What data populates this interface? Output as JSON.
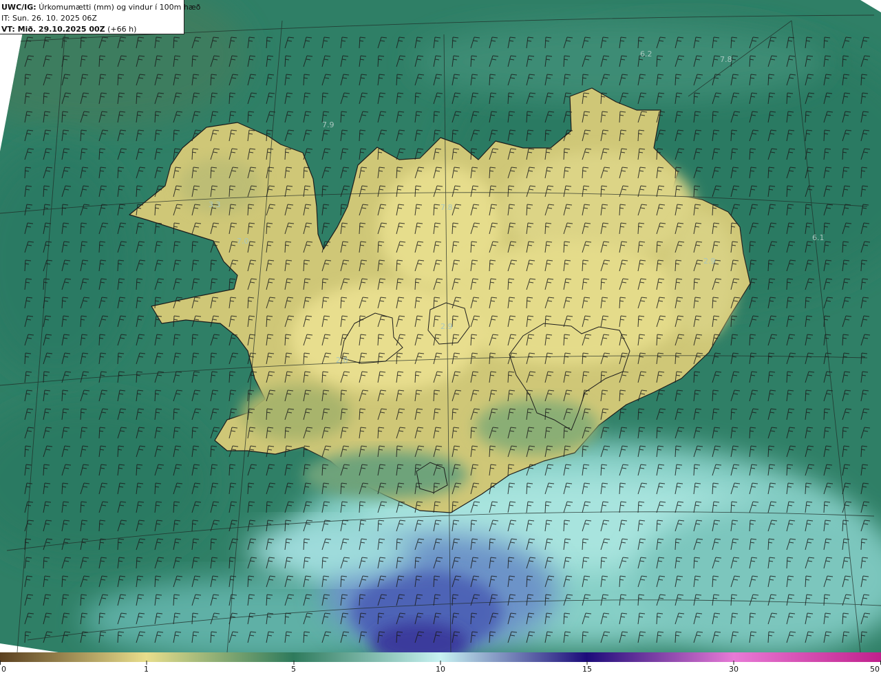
{
  "header": {
    "product_prefix": "UWC/IG:",
    "product_desc": "Úrkomumætti (mm) og vindur í 100m hæð",
    "init_time": "IT: Sun. 26. 10. 2025 06Z",
    "valid_prefix": "VT: Mið. 29.10.2025 00Z",
    "valid_suffix": "(+66 h)"
  },
  "map_labels": [
    {
      "text": "6.2"
    },
    {
      "text": "7.8"
    },
    {
      "text": "7.9"
    },
    {
      "text": "3.3"
    },
    {
      "text": "7.0"
    },
    {
      "text": "7.8"
    },
    {
      "text": "6.1"
    },
    {
      "text": "2.9"
    },
    {
      "text": "2.9"
    },
    {
      "text": "2.0"
    }
  ],
  "legend": {
    "ticks": [
      "0",
      "1",
      "5",
      "10",
      "15",
      "30",
      "50"
    ],
    "colors": [
      "#5b4020",
      "#b9a45e",
      "#e6de8c",
      "#2e7a5c",
      "#bff0f0",
      "#1e0e7c",
      "#e06cd0",
      "#c0208c"
    ]
  },
  "colors": {
    "land_low": "#e2d884",
    "sea": "#2a7c66",
    "sea_light": "#9cdcd6",
    "heavy_precip": "#4f62b4"
  }
}
